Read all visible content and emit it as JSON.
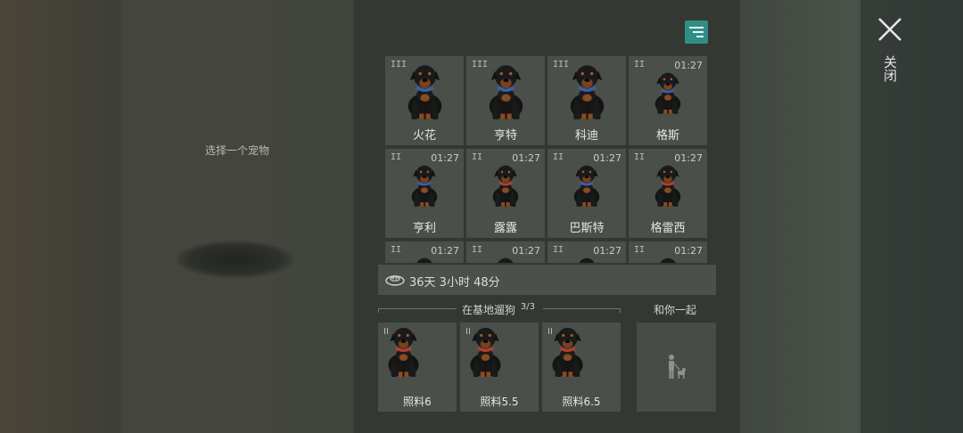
{
  "left": {
    "hint": "选择一个宠物"
  },
  "close": {
    "label": "关闭",
    "icon": "close-icon"
  },
  "filter": {
    "icon": "filter-sort-icon",
    "color": "#2f8f86"
  },
  "pets": [
    {
      "tier": "III",
      "timer": "",
      "name": "火花",
      "collar": "#3a5fb0",
      "pose": "sit-large"
    },
    {
      "tier": "III",
      "timer": "",
      "name": "亨特",
      "collar": "#3a5fb0",
      "pose": "sit-large"
    },
    {
      "tier": "III",
      "timer": "",
      "name": "科迪",
      "collar": "#3a5fb0",
      "pose": "sit-large"
    },
    {
      "tier": "II",
      "timer": "01:27",
      "name": "格斯",
      "collar": "#3a5fb0",
      "pose": "sit-small"
    },
    {
      "tier": "II",
      "timer": "01:27",
      "name": "亨利",
      "collar": "#3a5fb0",
      "pose": "sit-small"
    },
    {
      "tier": "II",
      "timer": "01:27",
      "name": "露露",
      "collar": "#c0392b",
      "pose": "sit-small"
    },
    {
      "tier": "II",
      "timer": "01:27",
      "name": "巴斯特",
      "collar": "#3a5fb0",
      "pose": "sit-small"
    },
    {
      "tier": "II",
      "timer": "01:27",
      "name": "格雷西",
      "collar": "#c0392b",
      "pose": "sit-small"
    },
    {
      "tier": "II",
      "timer": "01:27",
      "name": "",
      "collar": "#c0392b",
      "pose": "sit-small"
    },
    {
      "tier": "II",
      "timer": "01:27",
      "name": "",
      "collar": "#c0392b",
      "pose": "sit-small"
    },
    {
      "tier": "II",
      "timer": "01:27",
      "name": "",
      "collar": "#c0392b",
      "pose": "sit-small"
    },
    {
      "tier": "II",
      "timer": "01:27",
      "name": "",
      "collar": "#c0392b",
      "pose": "sit-small"
    }
  ],
  "food": {
    "icon": "food-bowl-icon",
    "text": "36天 3小时 48分"
  },
  "base_section": {
    "title": "在基地遛狗",
    "count": "3/3",
    "dogs": [
      {
        "tier": "II",
        "name": "照料6",
        "collar": "#c0392b"
      },
      {
        "tier": "II",
        "name": "照料5.5",
        "collar": "#c0392b"
      },
      {
        "tier": "II",
        "name": "照料6.5",
        "collar": "#c0392b"
      }
    ]
  },
  "with_you": {
    "title": "和你一起",
    "icon": "person-with-dog-icon"
  }
}
